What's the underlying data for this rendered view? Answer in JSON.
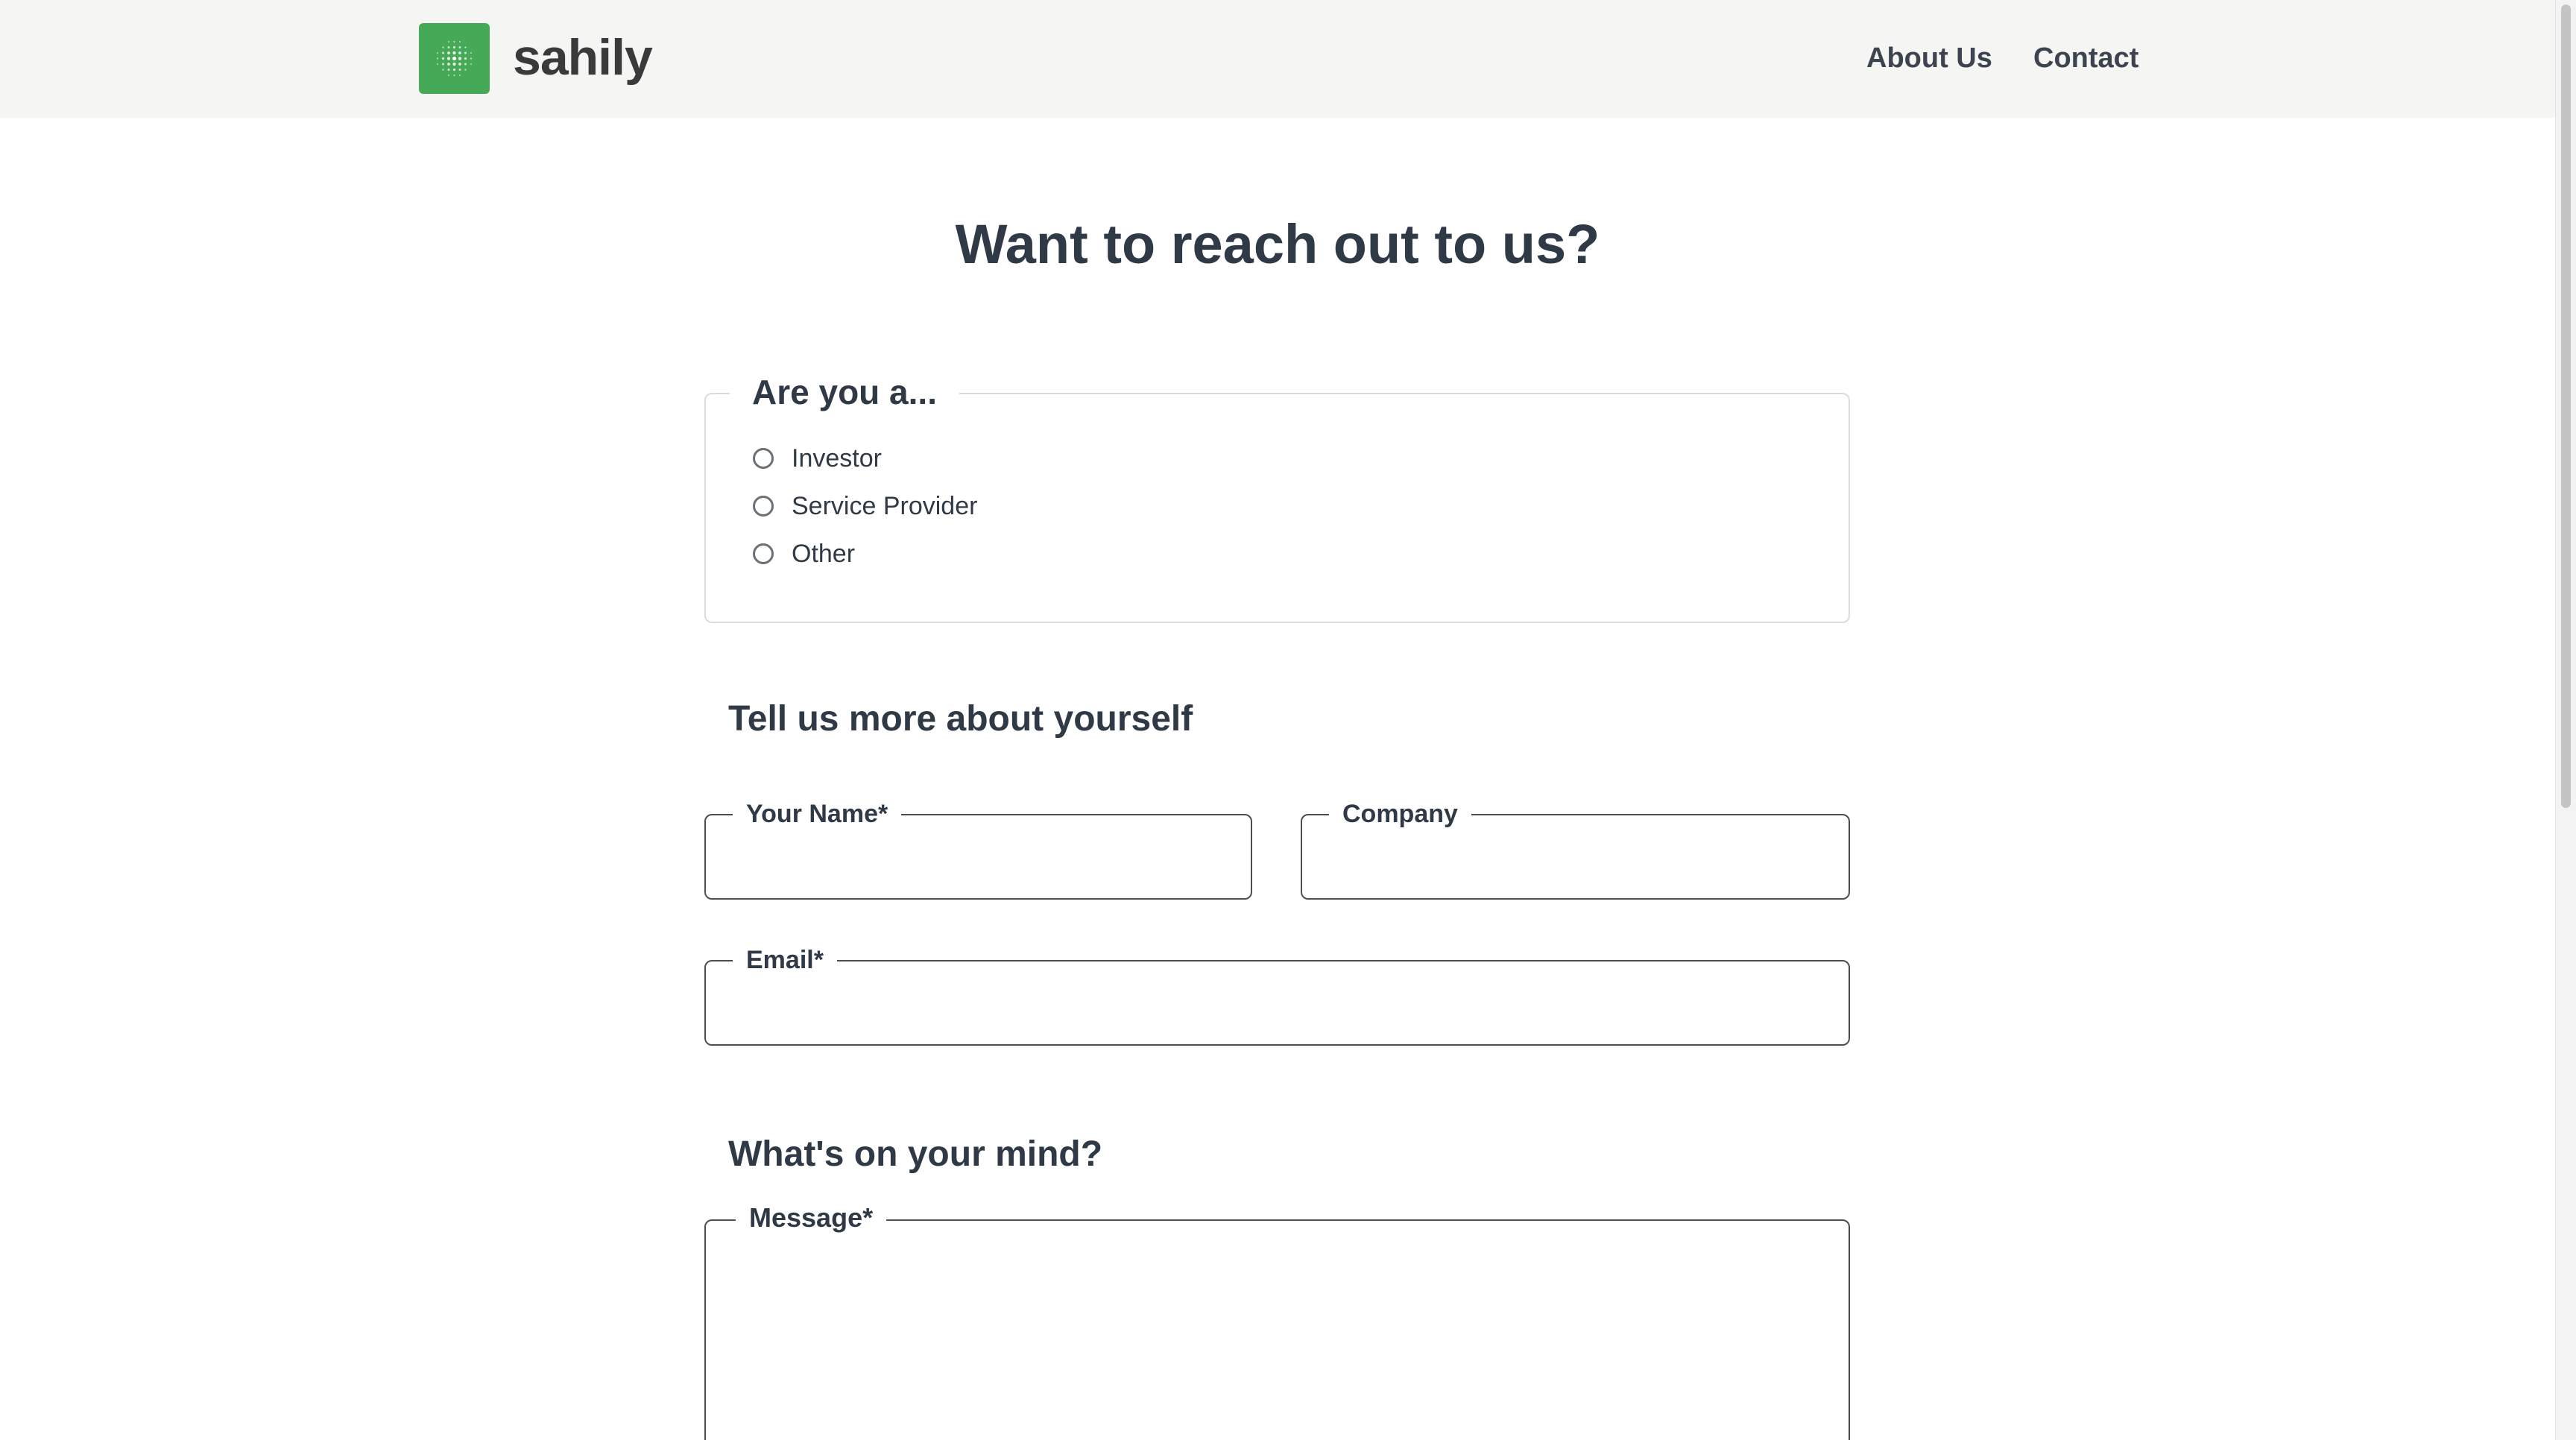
{
  "header": {
    "brand": "sahily",
    "logo_icon": "dot-grid-logo-icon",
    "logo_color": "#45a957",
    "nav": [
      {
        "label": "About Us"
      },
      {
        "label": "Contact"
      }
    ]
  },
  "main": {
    "title": "Want to reach out to us?",
    "role": {
      "legend": "Are you a...",
      "options": [
        {
          "label": "Investor",
          "selected": false
        },
        {
          "label": "Service Provider",
          "selected": false
        },
        {
          "label": "Other",
          "selected": false
        }
      ]
    },
    "about_heading": "Tell us more about yourself",
    "fields": {
      "name": {
        "label": "Your Name*",
        "value": ""
      },
      "company": {
        "label": "Company",
        "value": ""
      },
      "email": {
        "label": "Email*",
        "value": ""
      }
    },
    "mind_heading": "What's on your mind?",
    "message": {
      "label": "Message*",
      "value": ""
    }
  }
}
